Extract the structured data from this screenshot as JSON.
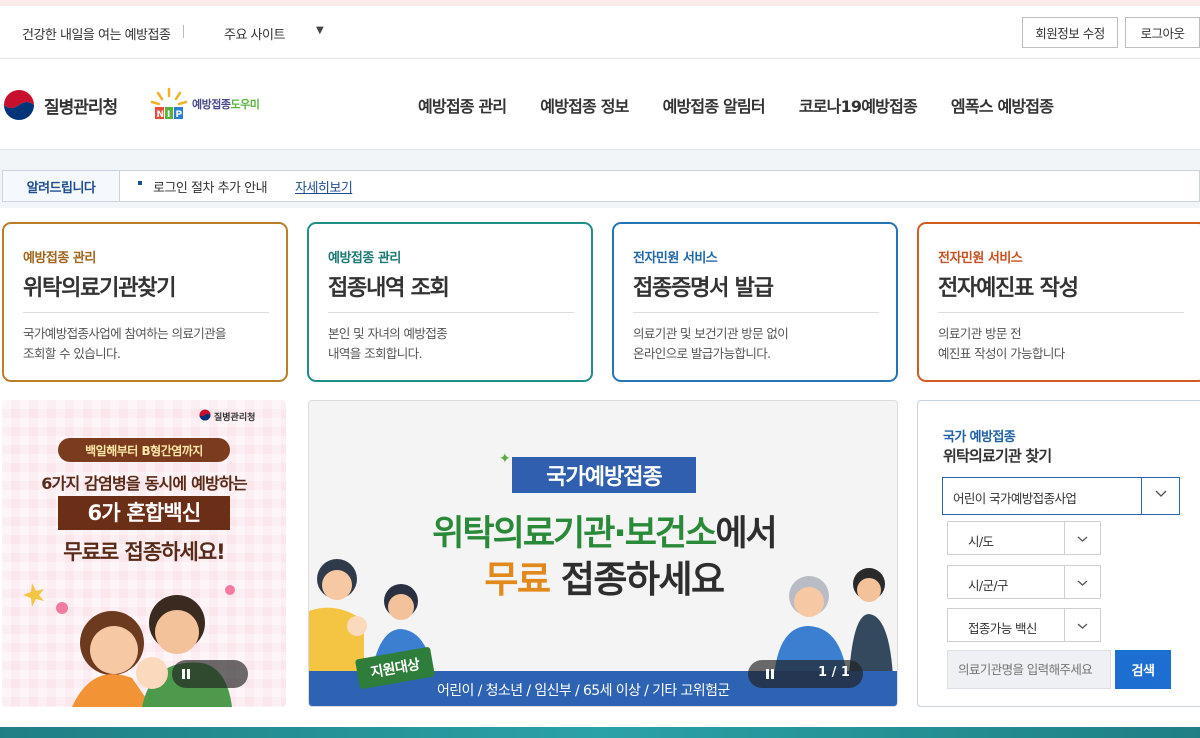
{
  "topbar": {
    "tagline": "건강한 내일을 여는 예방접종",
    "site_select": "주요 사이트",
    "member_edit": "회원정보 수정",
    "logout": "로그아웃"
  },
  "header": {
    "kdca_name": "질병관리청",
    "nip_name_a": "예방접종",
    "nip_name_b": "도우미",
    "nav": [
      "예방접종 관리",
      "예방접종 정보",
      "예방접종 알림터",
      "코로나19예방접종",
      "엠폭스 예방접종"
    ]
  },
  "notice": {
    "label": "알려드립니다",
    "text": "로그인 절차 추가 안내",
    "link": "자세히보기"
  },
  "cards": [
    {
      "category": "예방접종 관리",
      "title": "위탁의료기관찾기",
      "desc1": "국가예방접종사업에 참여하는 의료기관을",
      "desc2": "조회할 수 있습니다."
    },
    {
      "category": "예방접종 관리",
      "title": "접종내역 조회",
      "desc1": "본인 및 자녀의 예방접종",
      "desc2": "내역을 조회합니다."
    },
    {
      "category": "전자민원 서비스",
      "title": "접종증명서 발급",
      "desc1": "의료기관 및 보건기관 방문 없이",
      "desc2": "온라인으로 발급가능합니다."
    },
    {
      "category": "전자민원 서비스",
      "title": "전자예진표 작성",
      "desc1": "의료기관 방문 전",
      "desc2": "예진표 작성이 가능합니다"
    }
  ],
  "banner_left": {
    "agency": "질병관리청",
    "pill": "백일해부터 B형간염까지",
    "line1": "6가지 감염병을 동시에 예방하는",
    "box": "6가 혼합백신",
    "line3": "무료로 접종하세요!"
  },
  "banner_center": {
    "tag": "국가예방접종",
    "line1_a": "위탁의료기관·보건소",
    "line1_b": "에서",
    "line2_a": "무료",
    "line2_b": " 접종하세요",
    "badge": "지원대상",
    "bottom": "어린이 / 청소년 / 임신부 / 65세 이상 / 기타 고위험군",
    "counter": "1 / 1"
  },
  "search_panel": {
    "subtitle": "국가 예방접종",
    "title": "위탁의료기관 찾기",
    "program_select": "어린이 국가예방접종사업",
    "sido": "시/도",
    "sigungu": "시/군/구",
    "vaccine": "접종가능 백신",
    "input_placeholder": "의료기관명을 입력해주세요",
    "search_button": "검색"
  },
  "colors": {
    "primary_blue": "#1c6fd1",
    "card1": "#b97f2b",
    "card2": "#1f8f86",
    "card3": "#2574b8",
    "card4": "#d05b23"
  },
  "icons": [
    "chevron-down-icon",
    "pause-icon",
    "kdca-logo-icon",
    "nip-logo-icon"
  ]
}
